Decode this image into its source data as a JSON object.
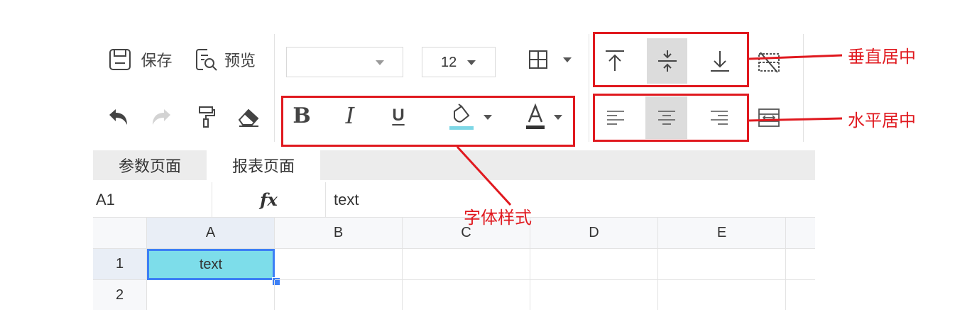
{
  "toolbar": {
    "save_label": "保存",
    "preview_label": "预览",
    "font_family_value": "",
    "font_size_value": "12"
  },
  "tabs": [
    {
      "label": "参数页面",
      "active": false
    },
    {
      "label": "报表页面",
      "active": true
    }
  ],
  "formula_bar": {
    "cell_ref": "A1",
    "fx_label": "fx",
    "value": "text"
  },
  "grid": {
    "columns": [
      "A",
      "B",
      "C",
      "D",
      "E"
    ],
    "rows": [
      "1",
      "2"
    ],
    "cells": {
      "A1": "text"
    }
  },
  "annotations": {
    "vertical_center": "垂直居中",
    "horizontal_center": "水平居中",
    "font_style": "字体样式"
  },
  "colors": {
    "annotation_red": "#e0191f",
    "selected_cell_fill": "#7dddea",
    "selection_border": "#3d7ff5",
    "fill_color_bar": "#7dd7e6",
    "active_button_bg": "#dcdcdc"
  }
}
